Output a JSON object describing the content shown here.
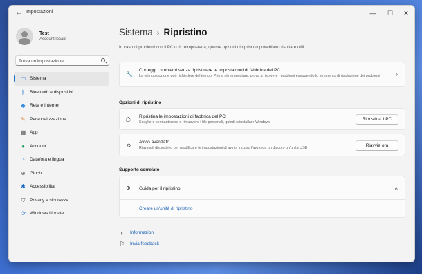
{
  "window": {
    "title": "Impostazioni",
    "back_glyph": "←",
    "minimize_glyph": "—",
    "maximize_glyph": "☐",
    "close_glyph": "✕"
  },
  "profile": {
    "name": "Test",
    "account": "Account locale"
  },
  "search": {
    "placeholder": "Trova un'impostazione"
  },
  "nav": {
    "items": [
      {
        "label": "Sistema",
        "icon": "system-icon",
        "glyph": "▭",
        "color": "#2b7fd6",
        "active": true
      },
      {
        "label": "Bluetooth e dispositivi",
        "icon": "bluetooth-icon",
        "glyph": "ᛒ",
        "color": "#1a6fc9"
      },
      {
        "label": "Rete e Internet",
        "icon": "wifi-icon",
        "glyph": "◆",
        "color": "#3a8fe0"
      },
      {
        "label": "Personalizzazione",
        "icon": "brush-icon",
        "glyph": "✎",
        "color": "#d9822b"
      },
      {
        "label": "App",
        "icon": "apps-icon",
        "glyph": "▦",
        "color": "#555555"
      },
      {
        "label": "Account",
        "icon": "account-icon",
        "glyph": "●",
        "color": "#2aa36b"
      },
      {
        "label": "Data/ora e lingua",
        "icon": "globe-clock-icon",
        "glyph": "◔",
        "color": "#2b7fd6"
      },
      {
        "label": "Giochi",
        "icon": "gamepad-icon",
        "glyph": "⊕",
        "color": "#777777"
      },
      {
        "label": "Accessibilità",
        "icon": "accessibility-icon",
        "glyph": "✱",
        "color": "#1a6fc9"
      },
      {
        "label": "Privacy e sicurezza",
        "icon": "shield-icon",
        "glyph": "⛉",
        "color": "#666666"
      },
      {
        "label": "Windows Update",
        "icon": "update-icon",
        "glyph": "⟳",
        "color": "#1a6fc9"
      }
    ]
  },
  "main": {
    "breadcrumb_parent": "Sistema",
    "breadcrumb_sep": "›",
    "breadcrumb_current": "Ripristino",
    "intro": "In caso di problemi con il PC o di reimpostarla, queste opzioni di ripristino potrebbero risultare utili",
    "troubleshoot": {
      "title": "Correggi i problemi senza ripristinare le impostazioni di fabbrica del PC",
      "desc": "La reimpostazione può richiedere del tempo. Prima di reimpostare, prova a risolvere i problemi eseguendo lo strumento di risoluzione dei problemi",
      "icon_glyph": "🔧",
      "chevron": "›"
    },
    "options_heading": "Opzioni di ripristino",
    "reset": {
      "title": "Ripristina le impostazioni di fabbrica del PC",
      "desc": "Scegliere se mantenere o rimuovere i file personali, quindi reinstallare Windows",
      "button": "Ripristina il PC",
      "icon_glyph": "⎙"
    },
    "advanced": {
      "title": "Avvio avanzato",
      "desc": "Riavvia il dispositivo per modificare le impostazioni di avvio, incluso l'avvio da un disco o un'unità USB",
      "button": "Riavvia ora",
      "icon_glyph": "⟲"
    },
    "related_heading": "Supporto correlato",
    "help": {
      "title": "Guida per il ripristino",
      "icon_glyph": "⊕",
      "chevron": "˄",
      "link": "Creare un'unità di ripristino"
    },
    "footer": {
      "info": "Informazioni",
      "feedback": "Invia feedback",
      "info_glyph": "◑",
      "feedback_glyph": "⚐"
    }
  },
  "colors": {
    "accent": "#1a6fc9",
    "link": "#1a5fb4"
  }
}
